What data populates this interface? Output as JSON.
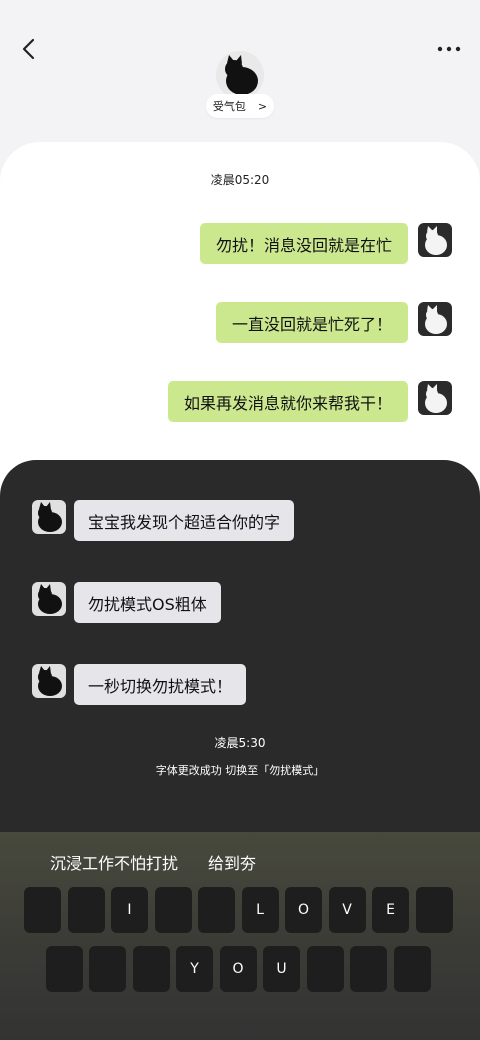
{
  "header": {
    "contact_name": "受气包",
    "contact_chevron": ">"
  },
  "chat": {
    "timestamp_top": "凌晨05:20",
    "outgoing": [
      "勿扰！消息没回就是在忙",
      "一直没回就是忙死了！",
      "如果再发消息就你来帮我干！"
    ],
    "incoming": [
      "宝宝我发现个超适合你的字",
      "勿扰模式OS粗体",
      "一秒切换勿扰模式！"
    ],
    "timestamp_bottom": "凌晨5:30",
    "system_note": "字体更改成功  切换至「勿扰模式」"
  },
  "keyboard": {
    "suggestions": [
      "沉浸工作不怕打扰",
      "给到夯"
    ],
    "row1": [
      "",
      "",
      "I",
      "",
      "",
      "L",
      "O",
      "V",
      "E",
      ""
    ],
    "row2": [
      "",
      "",
      "",
      "Y",
      "O",
      "U",
      "",
      "",
      ""
    ]
  },
  "colors": {
    "outgoing_bubble": "#cce88f",
    "incoming_bubble": "#e5e5ea",
    "dark_panel": "#2a2a2a"
  }
}
